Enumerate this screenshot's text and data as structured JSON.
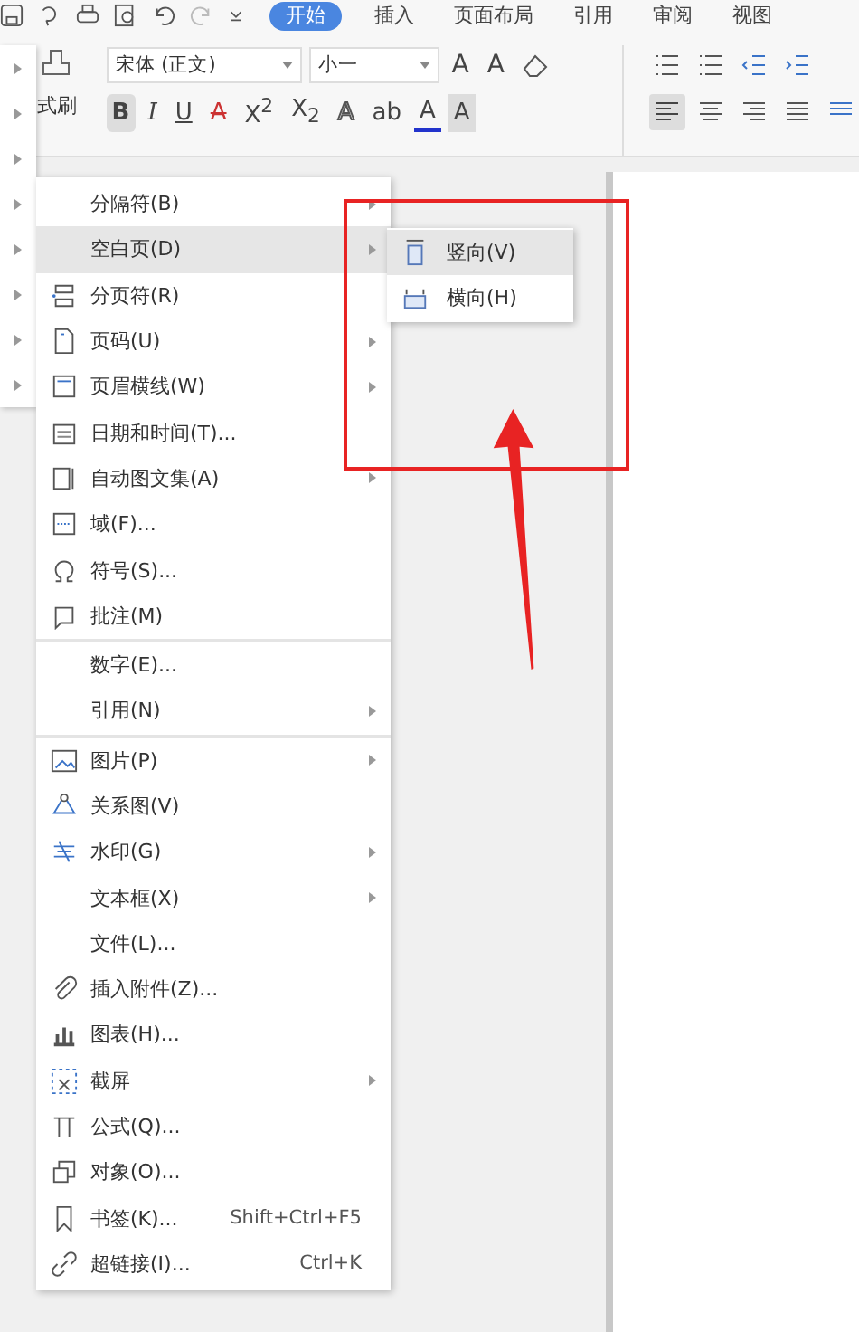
{
  "ribbon_tabs": [
    {
      "label": "开始",
      "selected": true
    },
    {
      "label": "插入",
      "selected": false
    },
    {
      "label": "页面布局",
      "selected": false
    },
    {
      "label": "引用",
      "selected": false
    },
    {
      "label": "审阅",
      "selected": false
    },
    {
      "label": "视图",
      "selected": false
    }
  ],
  "toolbar": {
    "format_painter": "式刷",
    "font_name": "宋体 (正文)",
    "font_size": "小一",
    "grow_font": "A",
    "shrink_font": "A",
    "bold": "B",
    "italic": "I",
    "underline": "U",
    "strikethrough": "A",
    "superscript": "X$^{2}$",
    "subscript": "X$_{2}$",
    "text_effect": "A",
    "highlight": "ab",
    "font_color": "A",
    "char_shading": "A"
  },
  "insert_menu": [
    {
      "label": "分隔符(B)",
      "submenu": true,
      "selected": false,
      "separator_before": false
    },
    {
      "label": "空白页(D)",
      "submenu": true,
      "selected": true,
      "separator_before": false
    },
    {
      "label": "分页符(R)",
      "submenu": false,
      "selected": false,
      "separator_before": false
    },
    {
      "label": "页码(U)",
      "submenu": true,
      "selected": false,
      "separator_before": false
    },
    {
      "label": "页眉横线(W)",
      "submenu": true,
      "selected": false,
      "separator_before": false
    },
    {
      "label": "日期和时间(T)...",
      "submenu": false,
      "selected": false,
      "separator_before": false
    },
    {
      "label": "自动图文集(A)",
      "submenu": true,
      "selected": false,
      "separator_before": false
    },
    {
      "label": "域(F)...",
      "submenu": false,
      "selected": false,
      "separator_before": false
    },
    {
      "label": "符号(S)...",
      "submenu": false,
      "selected": false,
      "separator_before": false
    },
    {
      "label": "批注(M)",
      "submenu": false,
      "selected": false,
      "separator_before": false
    },
    {
      "label": "数字(E)...",
      "submenu": false,
      "selected": false,
      "separator_before": true
    },
    {
      "label": "引用(N)",
      "submenu": true,
      "selected": false,
      "separator_before": false
    },
    {
      "label": "图片(P)",
      "submenu": true,
      "selected": false,
      "separator_before": true
    },
    {
      "label": "关系图(V)",
      "submenu": false,
      "selected": false,
      "separator_before": false
    },
    {
      "label": "水印(G)",
      "submenu": true,
      "selected": false,
      "separator_before": false
    },
    {
      "label": "文本框(X)",
      "submenu": true,
      "selected": false,
      "separator_before": false
    },
    {
      "label": "文件(L)...",
      "submenu": false,
      "selected": false,
      "separator_before": false
    },
    {
      "label": "插入附件(Z)...",
      "submenu": false,
      "selected": false,
      "separator_before": false
    },
    {
      "label": "图表(H)...",
      "submenu": false,
      "selected": false,
      "separator_before": false
    },
    {
      "label": "截屏",
      "submenu": true,
      "selected": false,
      "separator_before": false
    },
    {
      "label": "公式(Q)...",
      "submenu": false,
      "selected": false,
      "separator_before": false
    },
    {
      "label": "对象(O)...",
      "submenu": false,
      "selected": false,
      "separator_before": false
    },
    {
      "label": "书签(K)...",
      "submenu": false,
      "selected": false,
      "separator_before": false,
      "shortcut": "Shift+Ctrl+F5"
    },
    {
      "label": "超链接(I)...",
      "submenu": false,
      "selected": false,
      "separator_before": false,
      "shortcut": "Ctrl+K"
    }
  ],
  "blank_page_submenu": [
    {
      "label": "竖向(V)",
      "selected": true
    },
    {
      "label": "横向(H)",
      "selected": false
    }
  ]
}
